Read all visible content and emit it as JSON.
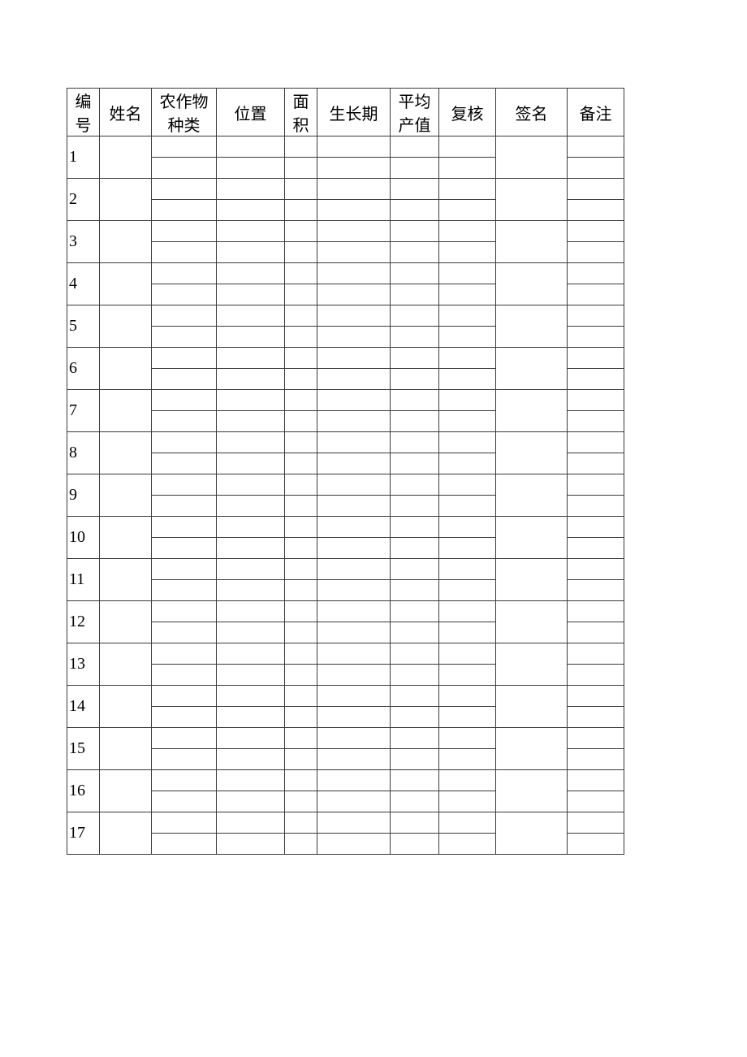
{
  "headers": [
    "编号",
    "姓名",
    "农作物种类",
    "位置",
    "面积",
    "生长期",
    "平均产值",
    "复核",
    "签名",
    "备注"
  ],
  "rows": [
    "1",
    "2",
    "3",
    "4",
    "5",
    "6",
    "7",
    "8",
    "9",
    "10",
    "11",
    "12",
    "13",
    "14",
    "15",
    "16",
    "17"
  ]
}
